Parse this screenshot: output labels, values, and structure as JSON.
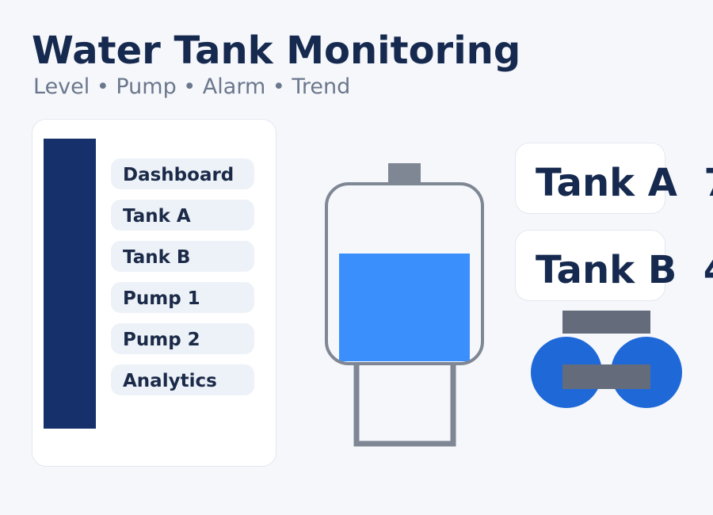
{
  "header": {
    "title": "Water Tank Monitoring",
    "subtitle": "Level • Pump • Alarm • Trend"
  },
  "sidebar": {
    "items": [
      {
        "label": "Dashboard"
      },
      {
        "label": "Tank A"
      },
      {
        "label": "Tank B"
      },
      {
        "label": "Pump 1"
      },
      {
        "label": "Pump 2"
      },
      {
        "label": "Analytics"
      }
    ]
  },
  "tank": {
    "fill_fraction": 0.62,
    "colors": {
      "outline": "#7f8794",
      "water": "#3a8ffd"
    }
  },
  "readouts": [
    {
      "label": "Tank A",
      "value_partial": "7"
    },
    {
      "label": "Tank B",
      "value_partial": "4"
    }
  ],
  "pump": {
    "colors": {
      "body": "#1f68d8",
      "plate": "#646c7b"
    }
  },
  "theme": {
    "accent": "#15306a",
    "title": "#16294f",
    "muted": "#6b778c"
  }
}
